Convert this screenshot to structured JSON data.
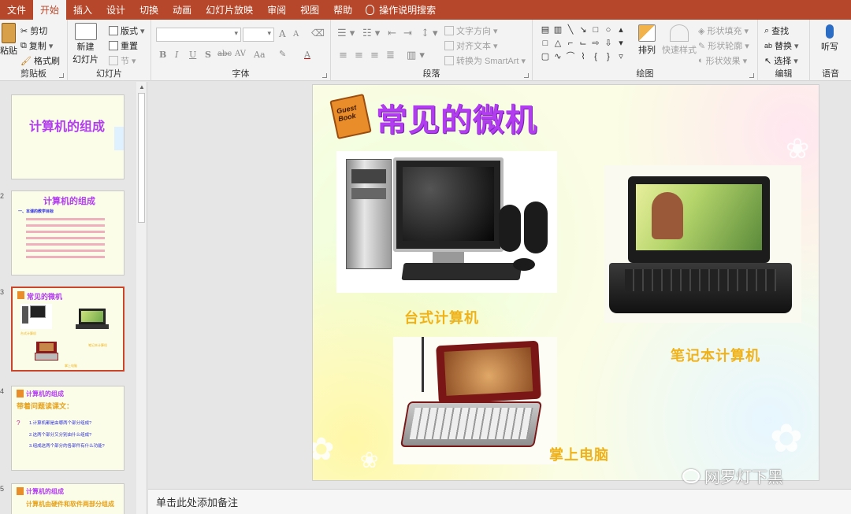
{
  "tabs": [
    "文件",
    "开始",
    "插入",
    "设计",
    "切换",
    "动画",
    "幻灯片放映",
    "审阅",
    "视图",
    "帮助"
  ],
  "tell_me": "操作说明搜索",
  "ribbon": {
    "clipboard": {
      "paste": "粘贴",
      "cut": "剪切",
      "copy": "复制",
      "format_painter": "格式刷",
      "label": "剪贴板"
    },
    "slides": {
      "new_slide_line1": "新建",
      "new_slide_line2": "幻灯片",
      "layout": "版式",
      "reset": "重置",
      "section": "节",
      "label": "幻灯片"
    },
    "font": {
      "label": "字体",
      "bold": "B",
      "italic": "I",
      "underline": "U",
      "shadow": "S",
      "strike": "abc",
      "spacing": "AV",
      "case": "Aa",
      "grow": "A",
      "shrink": "A"
    },
    "paragraph": {
      "text_direction": "文字方向",
      "align_text": "对齐文本",
      "smartart": "转换为 SmartArt",
      "label": "段落"
    },
    "drawing": {
      "arrange": "排列",
      "quick_styles": "快速样式",
      "shape_fill": "形状填充",
      "shape_outline": "形状轮廓",
      "shape_effects": "形状效果",
      "label": "绘图"
    },
    "editing": {
      "find": "查找",
      "replace": "替换",
      "select": "选择",
      "label": "编辑"
    },
    "voice": {
      "dictate": "听写",
      "label": "语音"
    }
  },
  "thumbnails": [
    {
      "num": "",
      "title": "计算机的组成"
    },
    {
      "num": "2",
      "title": "计算机的组成",
      "subtitle": "一、本课的教学目标"
    },
    {
      "num": "3",
      "title": "常见的微机",
      "cap1": "台式计算机",
      "cap2": "笔记本计算机",
      "cap3": "掌上电脑"
    },
    {
      "num": "4",
      "title": "计算机的组成",
      "subtitle": "带着问题读课文：",
      "q1": "1.计算机都是由哪两个部分组成?",
      "q2": "2.这两个部分又分别由什么组成?",
      "q3": "3.组成这两个部分的各部件有什么功能?"
    },
    {
      "num": "5",
      "title": "计算机的组成",
      "line1": "计算机由硬件和软件两部分组成"
    }
  ],
  "slide": {
    "title": "常见的微机",
    "book_text": "Guest Book",
    "caption_desktop": "台式计算机",
    "caption_laptop": "笔记本计算机",
    "caption_handheld": "掌上电脑"
  },
  "notes_placeholder": "单击此处添加备注",
  "watermark": "网罗灯下黑",
  "colors": {
    "accent": "#b7472a",
    "title_purple": "#b23cf0",
    "caption_gold": "#f0b21a",
    "selected_border": "#c8452c"
  }
}
